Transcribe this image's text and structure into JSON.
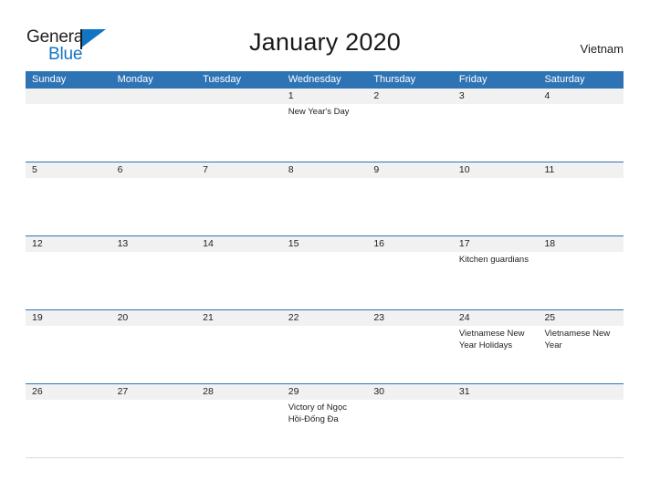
{
  "brand": {
    "word_one": "General",
    "word_two": "Blue",
    "mark_icon": "triangle-flag-icon",
    "mark_color": "#1275c4"
  },
  "header": {
    "title": "January 2020",
    "region": "Vietnam"
  },
  "colors": {
    "header_blue": "#2e74b5",
    "row_band_gray": "#f1f1f1",
    "text": "#222222",
    "brand_blue": "#1275c4"
  },
  "calendar": {
    "month": "January",
    "year": "2020",
    "weekday_headers": [
      "Sunday",
      "Monday",
      "Tuesday",
      "Wednesday",
      "Thursday",
      "Friday",
      "Saturday"
    ],
    "weeks": [
      {
        "days": [
          {
            "num": "",
            "event": ""
          },
          {
            "num": "",
            "event": ""
          },
          {
            "num": "",
            "event": ""
          },
          {
            "num": "1",
            "event": "New Year's Day"
          },
          {
            "num": "2",
            "event": ""
          },
          {
            "num": "3",
            "event": ""
          },
          {
            "num": "4",
            "event": ""
          }
        ]
      },
      {
        "days": [
          {
            "num": "5",
            "event": ""
          },
          {
            "num": "6",
            "event": ""
          },
          {
            "num": "7",
            "event": ""
          },
          {
            "num": "8",
            "event": ""
          },
          {
            "num": "9",
            "event": ""
          },
          {
            "num": "10",
            "event": ""
          },
          {
            "num": "11",
            "event": ""
          }
        ]
      },
      {
        "days": [
          {
            "num": "12",
            "event": ""
          },
          {
            "num": "13",
            "event": ""
          },
          {
            "num": "14",
            "event": ""
          },
          {
            "num": "15",
            "event": ""
          },
          {
            "num": "16",
            "event": ""
          },
          {
            "num": "17",
            "event": "Kitchen guardians"
          },
          {
            "num": "18",
            "event": ""
          }
        ]
      },
      {
        "days": [
          {
            "num": "19",
            "event": ""
          },
          {
            "num": "20",
            "event": ""
          },
          {
            "num": "21",
            "event": ""
          },
          {
            "num": "22",
            "event": ""
          },
          {
            "num": "23",
            "event": ""
          },
          {
            "num": "24",
            "event": "Vietnamese New Year Holidays"
          },
          {
            "num": "25",
            "event": "Vietnamese New Year"
          }
        ]
      },
      {
        "days": [
          {
            "num": "26",
            "event": ""
          },
          {
            "num": "27",
            "event": ""
          },
          {
            "num": "28",
            "event": ""
          },
          {
            "num": "29",
            "event": "Victory of Ngọc Hồi-Đống Đa"
          },
          {
            "num": "30",
            "event": ""
          },
          {
            "num": "31",
            "event": ""
          },
          {
            "num": "",
            "event": ""
          }
        ]
      }
    ]
  }
}
